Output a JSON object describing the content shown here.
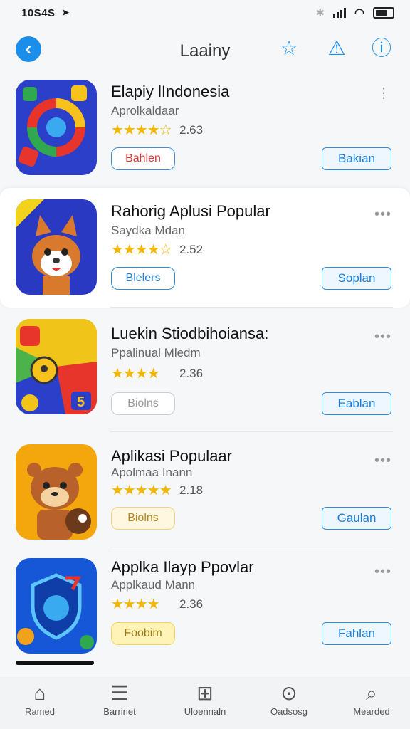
{
  "status": {
    "time": "10S4S",
    "location_icon": "location-arrow-icon"
  },
  "nav": {
    "title": "Laainy",
    "back_icon": "chevron-left-icon",
    "icons": [
      "star-icon",
      "alert-icon",
      "info-icon"
    ]
  },
  "apps": [
    {
      "title": "Elapiy lIndonesia",
      "subtitle": "Aprolkaldaar",
      "rating": "2.63",
      "stars": "★★★★☆",
      "left_btn": "Bahlen",
      "right_btn": "Bakian"
    },
    {
      "title": "Rahorig Aplusi Popular",
      "subtitle": "Saydka Mdan",
      "rating": "2.52",
      "stars": "★★★★☆",
      "left_btn": "Blelers",
      "right_btn": "Soplan"
    },
    {
      "title": "Luekin Stiodbihoiansa:",
      "subtitle": "Ppalinual Mledm",
      "rating": "2.36",
      "stars": "★★★★",
      "left_btn": "Biolns",
      "right_btn": "Eablan"
    },
    {
      "title": "Aplikasi Populaar",
      "subtitle": "Apolmaa Inann",
      "rating": "2.18",
      "stars": "★★★★★",
      "left_btn": "Biolns",
      "right_btn": "Gaulan"
    },
    {
      "title": "Applka Ilayp Ppovlar",
      "subtitle": "Applkaud Mann",
      "rating": "2.36",
      "stars": "★★★★",
      "left_btn": "Foobim",
      "right_btn": "Fahlan"
    }
  ],
  "tabs": [
    {
      "label": "Ramed",
      "icon": "home-icon"
    },
    {
      "label": "Barrinet",
      "icon": "list-icon"
    },
    {
      "label": "Uloennaln",
      "icon": "grid-icon"
    },
    {
      "label": "Oadsosg",
      "icon": "download-icon"
    },
    {
      "label": "Mearded",
      "icon": "search-icon"
    }
  ]
}
